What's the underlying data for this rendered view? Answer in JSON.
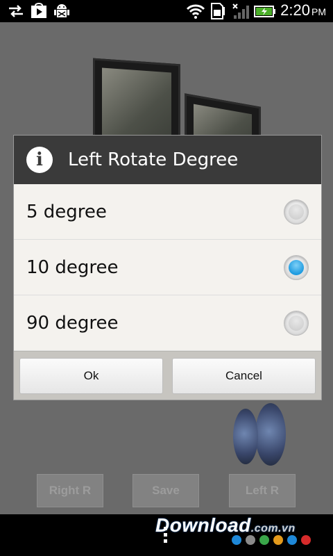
{
  "status_bar": {
    "time": "2:20",
    "ampm": "PM",
    "icons": [
      "sync-icon",
      "play-store-icon",
      "android-debug-icon",
      "wifi-icon",
      "sd-card-icon",
      "signal-icon",
      "battery-charging-icon"
    ]
  },
  "dialog": {
    "title": "Left Rotate Degree",
    "icon": "info-icon",
    "options": [
      {
        "label": "5 degree",
        "checked": false
      },
      {
        "label": "10 degree",
        "checked": true
      },
      {
        "label": "90 degree",
        "checked": false
      }
    ],
    "ok_label": "Ok",
    "cancel_label": "Cancel"
  },
  "app": {
    "right_label": "Right R",
    "save_label": "Save",
    "left_label": "Left R"
  },
  "watermark": {
    "text": "Download",
    "domain": ".com.vn",
    "dot_colors": [
      "#1e88d8",
      "#8a8a8a",
      "#3aa64a",
      "#e39a1c",
      "#1e88d8",
      "#d62b2b"
    ]
  },
  "colors": {
    "accent_radio": "#1e9be0",
    "dialog_header": "#3a3a3a"
  }
}
